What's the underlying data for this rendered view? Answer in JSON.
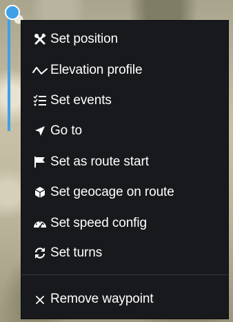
{
  "context_menu": {
    "items": [
      {
        "label": "Set position",
        "icon": "tools-icon"
      },
      {
        "label": "Elevation profile",
        "icon": "elevation-icon"
      },
      {
        "label": "Set events",
        "icon": "checklist-icon"
      },
      {
        "label": "Go to",
        "icon": "navigation-arrow-icon"
      },
      {
        "label": "Set as route start",
        "icon": "flag-icon"
      },
      {
        "label": "Set geocage on route",
        "icon": "cube-icon"
      },
      {
        "label": "Set speed config",
        "icon": "speedometer-icon"
      },
      {
        "label": "Set turns",
        "icon": "refresh-icon"
      }
    ],
    "remove": {
      "label": "Remove waypoint",
      "icon": "close-icon"
    }
  },
  "colors": {
    "menu_background": "#18191d",
    "route": "#3da0e8",
    "text": "#ffffff"
  }
}
